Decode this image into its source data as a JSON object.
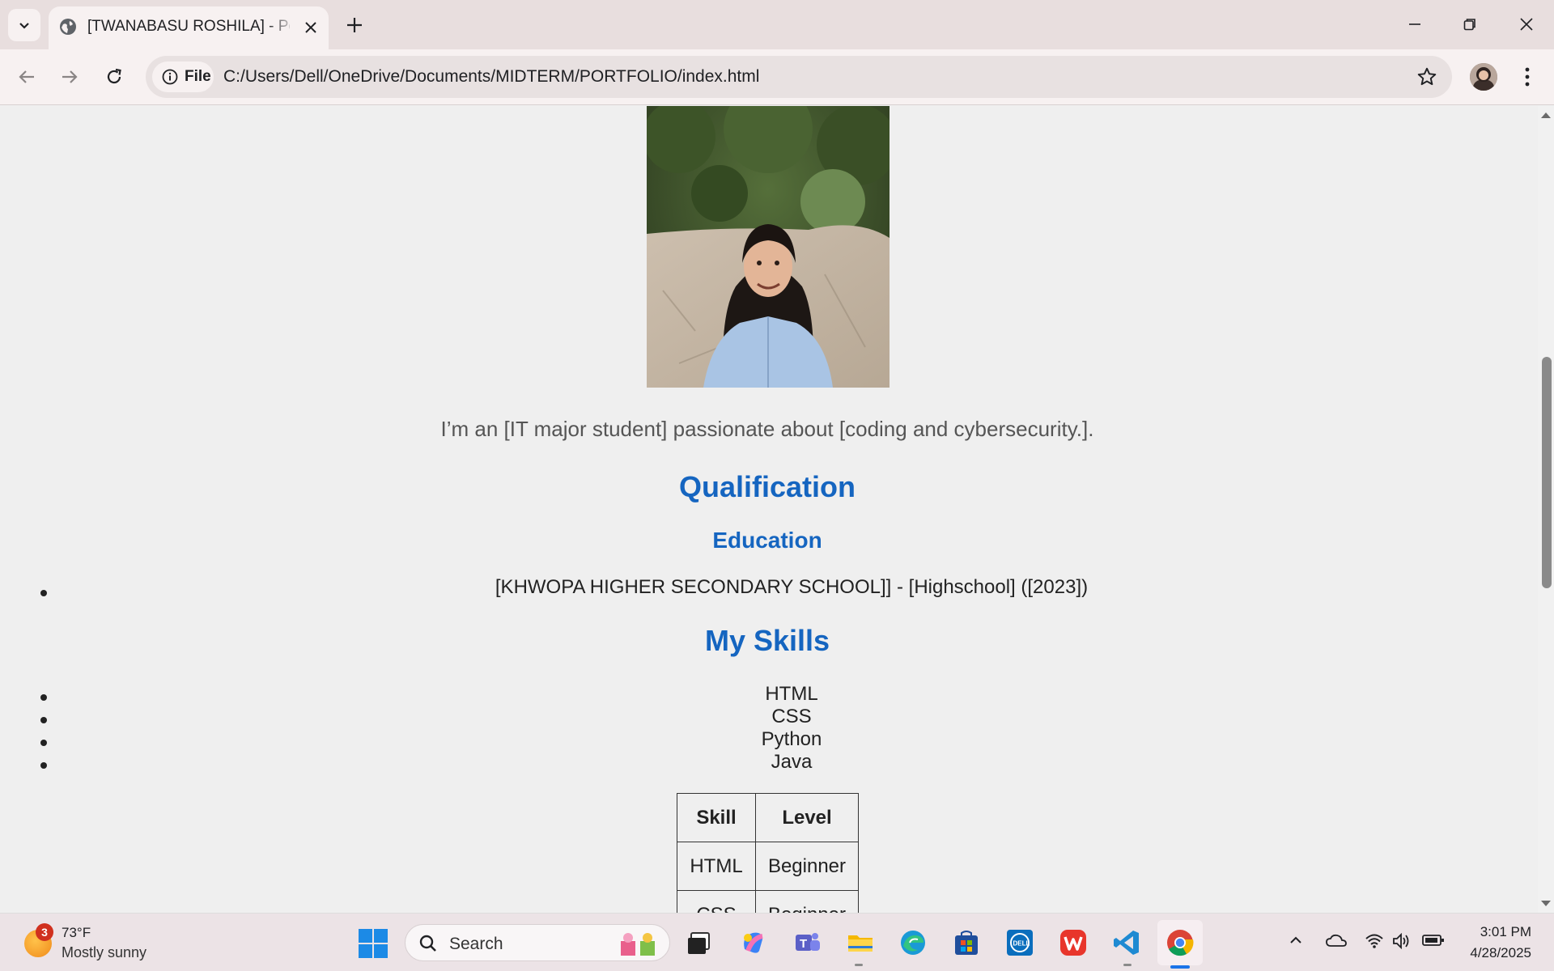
{
  "browser": {
    "tab_title": "[TWANABASU ROSHILA] - Portf",
    "chip_label": "File",
    "url": "C:/Users/Dell/OneDrive/Documents/MIDTERM/PORTFOLIO/index.html"
  },
  "page": {
    "intro": "I’m an [IT major student] passionate about [coding and cybersecurity.].",
    "qualification_heading": "Qualification",
    "education_heading": "Education",
    "education_items": [
      "[KHWOPA HIGHER SECONDARY SCHOOL]] - [Highschool] ([2023])"
    ],
    "skills_heading": "My Skills",
    "skills": [
      "HTML",
      "CSS",
      "Python",
      "Java"
    ],
    "table": {
      "headers": [
        "Skill",
        "Level"
      ],
      "rows": [
        [
          "HTML",
          "Beginner"
        ],
        [
          "CSS",
          "Beginner"
        ]
      ]
    }
  },
  "taskbar": {
    "weather_badge": "3",
    "temperature": "73°F",
    "condition": "Mostly sunny",
    "search_label": "Search",
    "time": "3:01 PM",
    "date": "4/28/2025"
  },
  "colors": {
    "heading": "#1565c0",
    "page_bg": "#efefef",
    "tab_strip": "#e8dede"
  }
}
